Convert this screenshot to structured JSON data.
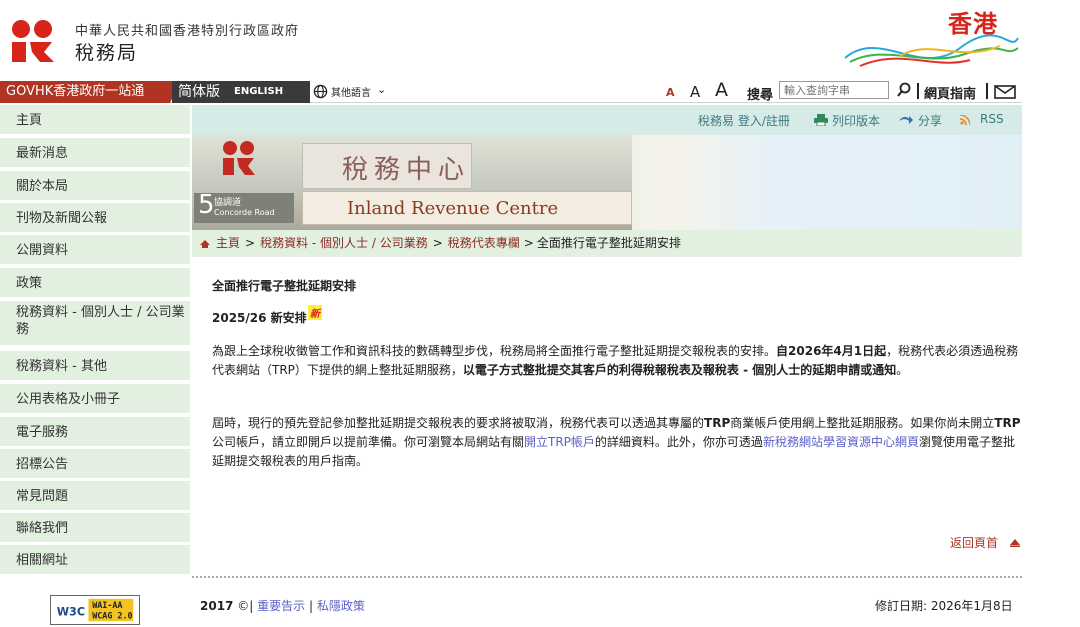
{
  "header": {
    "gov_name": "中華人民共和國香港特別行政區政府",
    "dept_name": "稅務局",
    "brand_text": "香港"
  },
  "topbar": {
    "govhk": "GOVHK香港政府一站通",
    "simplified": "简体版",
    "english": "ENGLISH",
    "other_languages": "其他語言",
    "font_small": "A",
    "font_medium": "A",
    "font_large": "A",
    "search_label": "搜尋",
    "search_placeholder": "輸入查詢字串",
    "sitemap": "網頁指南"
  },
  "sidebar": {
    "items": [
      {
        "label": "主頁"
      },
      {
        "label": "最新消息"
      },
      {
        "label": "關於本局"
      },
      {
        "label": "刊物及新聞公報"
      },
      {
        "label": "公開資料"
      },
      {
        "label": "政策"
      },
      {
        "label": "稅務資料 - 個別人士 / 公司業務"
      },
      {
        "label": "稅務資料 - 其他"
      },
      {
        "label": "公用表格及小冊子"
      },
      {
        "label": "電子服務"
      },
      {
        "label": "招標公告"
      },
      {
        "label": "常見問題"
      },
      {
        "label": "聯絡我們"
      },
      {
        "label": "相關網址"
      }
    ],
    "w3c_badge": "WAI-AA WCAG 2.0"
  },
  "utility": {
    "login": "稅務易 登入/註冊",
    "print": "列印版本",
    "share": "分享",
    "rss": "RSS"
  },
  "banner": {
    "chinese_sign": "稅務中心",
    "english_sign": "Inland Revenue Centre",
    "road_number": "5",
    "road_name_cn": "協調道",
    "road_name_en": "Concorde Road"
  },
  "breadcrumb": {
    "home": "主頁",
    "level1": "稅務資料 - 個別人士 / 公司業務",
    "level2": "稅務代表專欄",
    "current": "全面推行電子整批延期安排"
  },
  "content": {
    "title": "全面推行電子整批延期安排",
    "subtitle": "2025/26 新安排",
    "new_badge": "新",
    "p1_a": "為跟上全球稅收徵管工作和資訊科技的數碼轉型步伐，稅務局將全面推行電子整批延期提交報稅表的安排。",
    "p1_b": "自2026年4月1日起",
    "p1_c": "，稅務代表必須透過稅務代表網站（TRP）下提供的網上整批延期服務，",
    "p1_d": "以電子方式整批提交其客戶的利得稅報稅表及報稅表 - 個別人士的延期申請或通知",
    "p1_e": "。",
    "p2_a": "屆時，現行的預先登記參加整批延期提交報稅表的要求將被取消，稅務代表可以透過其專屬的",
    "p2_b": "TRP",
    "p2_c": "商業帳戶使用網上整批延期服務。如果你尚未開立",
    "p2_d": "TRP",
    "p2_e": "公司帳戶，請立即開戶以提前準備。你可瀏覽本局網站有關",
    "p2_link1": "開立TRP帳戶",
    "p2_f": "的詳細資料。此外，你亦可透過",
    "p2_link2": "新稅務網站學習資源中心網頁",
    "p2_g": "瀏覽使用電子整批延期提交報稅表的用戶指南。"
  },
  "footer": {
    "back_to_top": "返回頁首",
    "year": "2017",
    "copyright_symbol": "©|",
    "notice": "重要告示",
    "divider": "|",
    "privacy": "私隱政策",
    "revised": "修訂日期: 2026年1月8日"
  }
}
